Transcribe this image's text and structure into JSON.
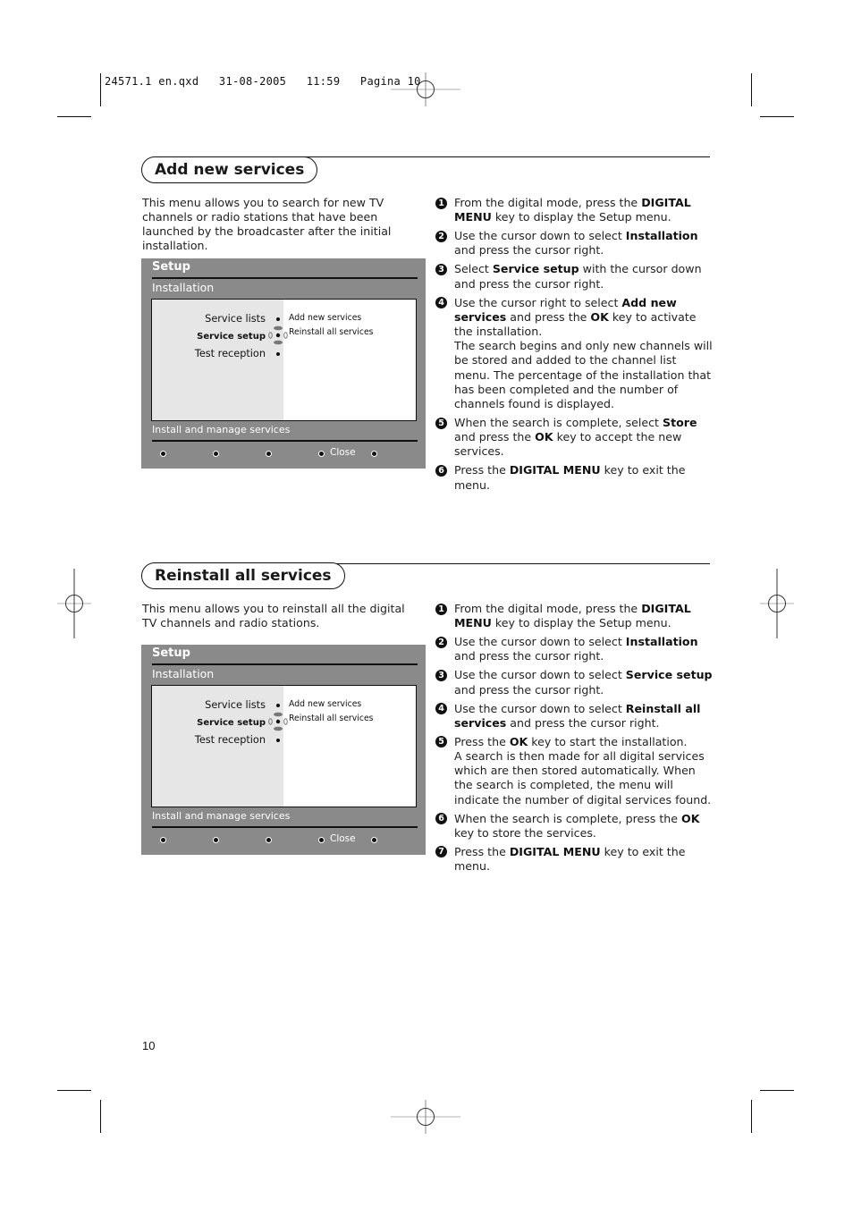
{
  "slug": "24571.1 en.qxd   31-08-2005   11:59   Pagina 10",
  "page_number": "10",
  "icons": {
    "registration_mark": "crosshair-circle-icon",
    "step_number": "filled-circle-number-icon",
    "cursor": "four-way-cursor-icon",
    "menu_button": "filled-dot-icon"
  },
  "colors": {
    "menu_background": "#8a8a8a",
    "menu_left_pane": "#e6e6e6",
    "menu_text": "#ffffff",
    "ink": "#111111"
  },
  "sections": [
    {
      "title": "Add new services",
      "intro": "This menu allows you to search for new TV channels or radio stations that have been launched by the broadcaster after the initial installation.",
      "menu": {
        "title": "Setup",
        "subtitle": "Installation",
        "left_items": [
          "Service lists",
          "Service setup",
          "Test reception"
        ],
        "selected_left": "Service setup",
        "right_items": [
          "Add new services",
          "Reinstall all services"
        ],
        "status": "Install and manage services",
        "close_label": "Close"
      },
      "steps": [
        {
          "num": "1",
          "html": "From the digital mode, press the <b>DIGITAL MENU</b> key to display the Setup menu."
        },
        {
          "num": "2",
          "html": "Use the cursor down to select <b>Installation</b> and press the cursor right."
        },
        {
          "num": "3",
          "html": "Select <b>Service setup</b> with the cursor down and press the cursor right."
        },
        {
          "num": "4",
          "html": "Use the cursor right to select <b>Add new services</b> and press the <b>OK</b> key to activate the installation.<br>The search begins and only new channels will be stored and added to the channel list menu. The percentage of the installation that has been completed and the number of channels found is displayed."
        },
        {
          "num": "5",
          "html": "When the search is complete, select <b>Store</b> and press the <b>OK</b> key to accept the new services."
        },
        {
          "num": "6",
          "html": "Press the <b>DIGITAL MENU</b> key to exit the menu."
        }
      ]
    },
    {
      "title": "Reinstall all services",
      "intro": "This menu allows you to reinstall all the digital TV channels and radio stations.",
      "menu": {
        "title": "Setup",
        "subtitle": "Installation",
        "left_items": [
          "Service lists",
          "Service setup",
          "Test reception"
        ],
        "selected_left": "Service setup",
        "right_items": [
          "Add new services",
          "Reinstall all services"
        ],
        "status": "Install and manage services",
        "close_label": "Close"
      },
      "steps": [
        {
          "num": "1",
          "html": "From the digital mode, press the <b>DIGITAL MENU</b> key to display the Setup menu."
        },
        {
          "num": "2",
          "html": "Use the cursor down to select <b>Installation</b> and press the cursor right."
        },
        {
          "num": "3",
          "html": "Use the cursor down to select <b>Service setup</b> and press the cursor right."
        },
        {
          "num": "4",
          "html": "Use the cursor down to select <b>Reinstall all services</b> and press the cursor right."
        },
        {
          "num": "5",
          "html": "Press the <b>OK</b> key to start the installation.<br>A search is then made for all digital services which are then stored automatically. When the search is completed, the menu will indicate the number of digital services found."
        },
        {
          "num": "6",
          "html": "When the search is complete, press the <b>OK</b> key to store the services."
        },
        {
          "num": "7",
          "html": "Press the <b>DIGITAL MENU</b> key to exit the menu."
        }
      ]
    }
  ]
}
